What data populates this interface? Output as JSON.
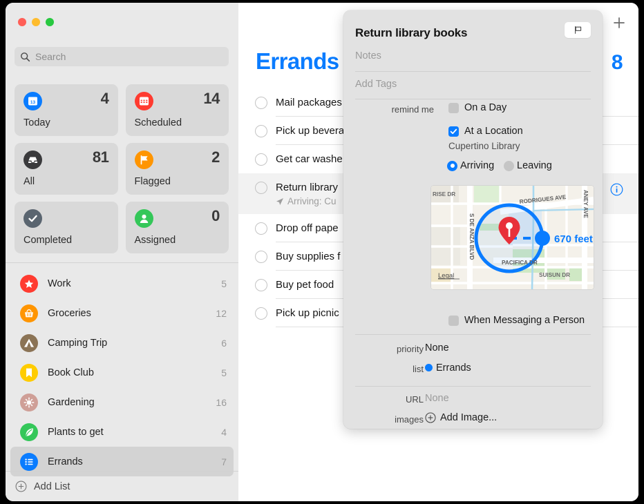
{
  "window": {
    "traffic_lights": [
      "close",
      "minimize",
      "zoom"
    ],
    "colors": {
      "accent": "#0a7cff",
      "sidebar_bg": "#e9e9e9",
      "popover_bg": "#e2e2e2"
    }
  },
  "sidebar": {
    "search": {
      "placeholder": "Search",
      "icon": "search-icon",
      "value": ""
    },
    "smart_cards": [
      {
        "label": "Today",
        "count": "4",
        "icon": "calendar-icon",
        "color": "#0a7cff",
        "day": "13"
      },
      {
        "label": "Scheduled",
        "count": "14",
        "icon": "calendar-red-icon",
        "color": "#ff3b30"
      },
      {
        "label": "All",
        "count": "81",
        "icon": "inbox-icon",
        "color": "#3a3a3c"
      },
      {
        "label": "Flagged",
        "count": "2",
        "icon": "flag-icon",
        "color": "#ff9500"
      },
      {
        "label": "Completed",
        "count": "",
        "icon": "checkmark-icon",
        "color": "#5a6570"
      },
      {
        "label": "Assigned",
        "count": "0",
        "icon": "person-icon",
        "color": "#34c759"
      }
    ],
    "lists": [
      {
        "name": "Work",
        "count": "5",
        "icon": "star-icon",
        "color": "#ff3b30"
      },
      {
        "name": "Groceries",
        "count": "12",
        "icon": "basket-icon",
        "color": "#ff9500"
      },
      {
        "name": "Camping Trip",
        "count": "6",
        "icon": "tent-icon",
        "color": "#8b7355"
      },
      {
        "name": "Book Club",
        "count": "5",
        "icon": "bookmark-icon",
        "color": "#ffcc00"
      },
      {
        "name": "Gardening",
        "count": "16",
        "icon": "sun-icon",
        "color": "#cf9f97"
      },
      {
        "name": "Plants to get",
        "count": "4",
        "icon": "leaf-icon",
        "color": "#34c759"
      },
      {
        "name": "Errands",
        "count": "7",
        "icon": "list-icon",
        "color": "#0a7cff",
        "selected": true
      }
    ],
    "add_list": {
      "label": "Add List",
      "icon": "plus-circle-icon"
    }
  },
  "main": {
    "add_button_icon": "plus-icon",
    "title": "Errands",
    "count": "8",
    "tasks": [
      {
        "title": "Mail packages",
        "subtitle": ""
      },
      {
        "title": "Pick up bevera",
        "subtitle": ""
      },
      {
        "title": "Get car washe",
        "subtitle": ""
      },
      {
        "title": "Return library",
        "subtitle": "Arriving: Cu",
        "subtitle_icon": "location-arrow-icon",
        "selected": true,
        "info_icon": "info-circle-icon"
      },
      {
        "title": "Drop off pape",
        "subtitle": ""
      },
      {
        "title": "Buy supplies f",
        "subtitle": ""
      },
      {
        "title": "Buy pet food",
        "subtitle": ""
      },
      {
        "title": "Pick up picnic",
        "subtitle": ""
      }
    ]
  },
  "popover": {
    "title": "Return library books",
    "flag_button_icon": "flag-outline-icon",
    "notes_placeholder": "Notes",
    "tags_placeholder": "Add Tags",
    "remind_me_label": "remind me",
    "options": {
      "on_a_day": {
        "label": "On a Day",
        "checked": false
      },
      "at_a_location": {
        "label": "At a Location",
        "checked": true,
        "detail": "Cupertino Library"
      },
      "arriving": {
        "label": "Arriving",
        "selected": true
      },
      "leaving": {
        "label": "Leaving",
        "selected": false
      },
      "when_messaging": {
        "label": "When Messaging a Person",
        "checked": false
      }
    },
    "map": {
      "radius_label": "670 feet",
      "legal_label": "Legal",
      "pin_icon": "map-pin-icon",
      "streets": [
        "RISE DR",
        "S DE ANZA BLVD",
        "RODRIGUES AVE",
        "PACIFICA DR",
        "SUISUN DR",
        "ANEY AVE"
      ]
    },
    "fields": [
      {
        "label": "priority",
        "value": "None",
        "dim": false
      },
      {
        "label": "list",
        "value": "Errands",
        "dim": false,
        "swatch": "#0a7cff"
      },
      {
        "label": "URL",
        "value": "None",
        "dim": true
      },
      {
        "label": "images",
        "value": "Add Image...",
        "dim": false,
        "icon": "plus-circle-icon"
      }
    ]
  }
}
